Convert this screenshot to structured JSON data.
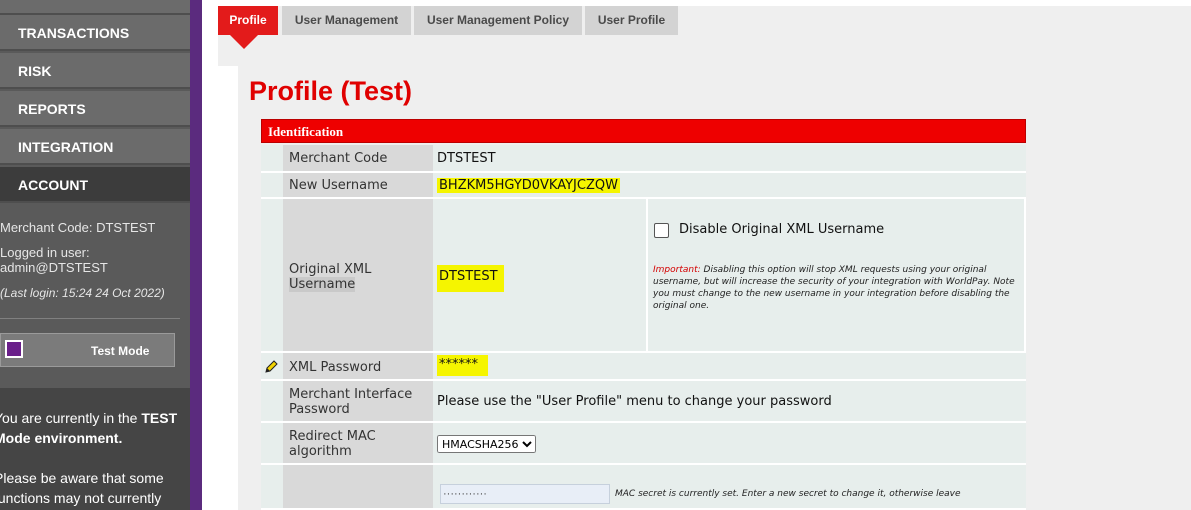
{
  "sidebar": {
    "nav": [
      {
        "label": "TRANSACTIONS",
        "active": false
      },
      {
        "label": "RISK",
        "active": false
      },
      {
        "label": "REPORTS",
        "active": false
      },
      {
        "label": "INTEGRATION",
        "active": false
      },
      {
        "label": "ACCOUNT",
        "active": true
      }
    ],
    "merchant_code_line": "Merchant Code: DTSTEST",
    "logged_in_label": "Logged in user:",
    "logged_in_user": "admin@DTSTEST",
    "last_login": "(Last login: 15:24 24 Oct 2022)",
    "test_mode_label": "Test Mode",
    "message_line1_prefix": "You are currently in the ",
    "message_line1_bold": "TEST",
    "message_line2": "Mode environment.",
    "message_line3": "Please be aware that some",
    "message_line4": "functions may not currently"
  },
  "tabs": [
    {
      "label": "Profile",
      "active": true
    },
    {
      "label": "User Management",
      "active": false
    },
    {
      "label": "User Management Policy",
      "active": false
    },
    {
      "label": "User Profile",
      "active": false
    }
  ],
  "page": {
    "title": "Profile (Test)",
    "section_header": "Identification"
  },
  "form": {
    "merchant_code": {
      "label": "Merchant Code",
      "value": "DTSTEST"
    },
    "new_username": {
      "label": "New Username",
      "value": "BHZKM5HGYD0VKAYJCZQW"
    },
    "original_xml_username": {
      "label_line1": "Original XML",
      "label_line2": "Username",
      "value": "DTSTEST",
      "checkbox_label": "Disable Original XML Username",
      "checkbox_checked": false,
      "important_prefix": "Important:",
      "important_text": " Disabling this option will stop XML requests using your original username, but will increase the security of your integration with WorldPay. Note you must change to the new username in your integration before disabling the original one."
    },
    "xml_password": {
      "label": "XML Password",
      "value": "******"
    },
    "merchant_interface_password": {
      "label_line1": "Merchant Interface",
      "label_line2": "Password",
      "value": "Please use the \"User Profile\" menu to change your password"
    },
    "redirect_mac": {
      "label_line1": "Redirect MAC",
      "label_line2": "algorithm",
      "selected": "HMACSHA256"
    },
    "mac_secret": {
      "value": "············",
      "note": "MAC secret is currently set. Enter a new secret to change it, otherwise leave"
    }
  }
}
